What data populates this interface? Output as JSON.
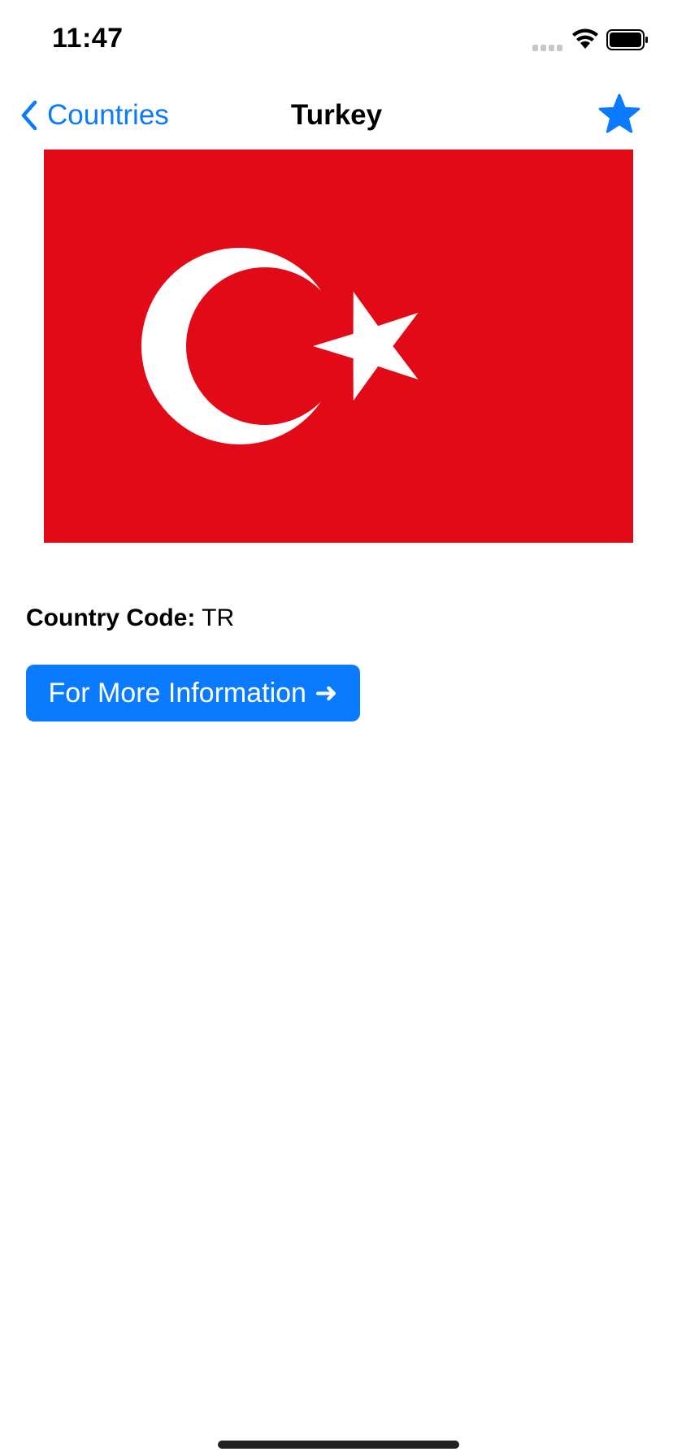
{
  "status_bar": {
    "time": "11:47",
    "icons": [
      "cellular-signal-icon",
      "wifi-icon",
      "battery-icon"
    ]
  },
  "nav": {
    "back_label": "Countries",
    "title": "Turkey",
    "favorite_icon": "star-filled-icon"
  },
  "country": {
    "code_label": "Country Code:",
    "code_value": "TR",
    "flag_icon": "flag-turkey"
  },
  "actions": {
    "more_info_label": "For More Information",
    "more_info_icon": "➜"
  },
  "colors": {
    "accent": "#0a7aff",
    "flag_red": "#e30a17",
    "flag_white": "#ffffff"
  }
}
